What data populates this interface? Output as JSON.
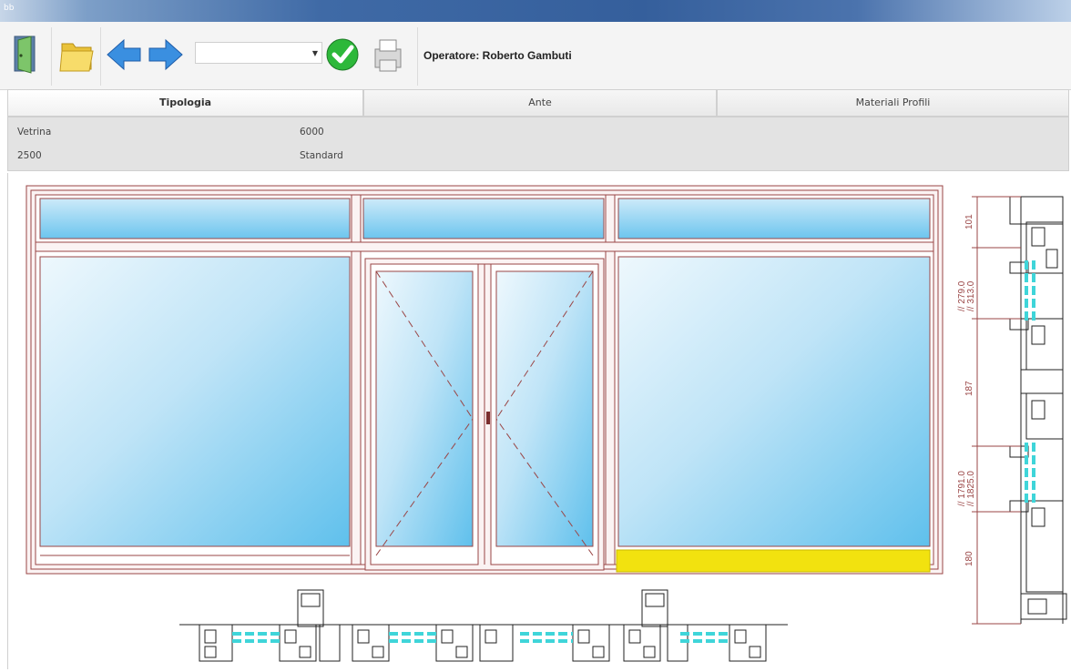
{
  "window": {
    "title": "bb"
  },
  "toolbar": {
    "buttons": [
      {
        "name": "exit-door-icon"
      },
      {
        "name": "open-folder-icon"
      },
      {
        "name": "back-arrow-icon"
      },
      {
        "name": "forward-arrow-icon"
      },
      {
        "name": "confirm-check-icon"
      },
      {
        "name": "print-icon"
      }
    ],
    "combo_value": "",
    "operator": "Operatore: Roberto Gambuti"
  },
  "tabs": [
    {
      "label": "Tipologia",
      "active": true
    },
    {
      "label": "Ante",
      "active": false
    },
    {
      "label": "Materiali Profili",
      "active": false
    }
  ],
  "info": {
    "type": "Vetrina",
    "width": "6000",
    "height": "2500",
    "variant": "Standard"
  },
  "dimensions": {
    "top": "101",
    "d1": "// 279.0",
    "d2": "// 313.0",
    "mid": "187",
    "d3": "// 1791.0",
    "d4": "// 1825.0",
    "bottom": "180"
  },
  "colors": {
    "glass_light": "#e9f5fc",
    "glass_dark": "#5fc0ec",
    "frame_line": "#9a4545",
    "sill": "#f2e20f",
    "gasket": "#3fd5d9"
  }
}
